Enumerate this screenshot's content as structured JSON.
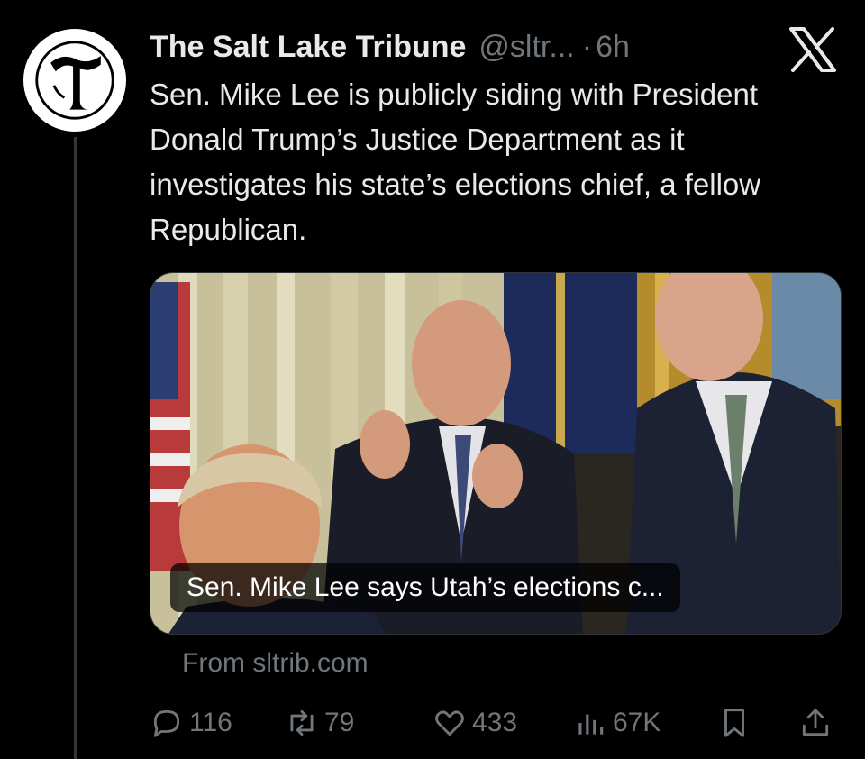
{
  "tweet": {
    "author_name": "The Salt Lake Tribune",
    "handle": "@sltr...",
    "separator": "·",
    "time": "6h",
    "text": "Sen. Mike Lee is publicly siding with President Donald Trump’s Justice Department as it investigates his state’s elections chief, a fellow Republican.",
    "media_caption": "Sen. Mike Lee says Utah’s elections c...",
    "source": "From sltrib.com",
    "avatar_icon": "tribune-t-logo",
    "platform_icon": "x-logo-icon"
  },
  "actions": {
    "replies": "116",
    "reposts": "79",
    "likes": "433",
    "views": "67K"
  },
  "colors": {
    "background": "#000000",
    "text": "#e7e9ea",
    "muted": "#71767b"
  }
}
